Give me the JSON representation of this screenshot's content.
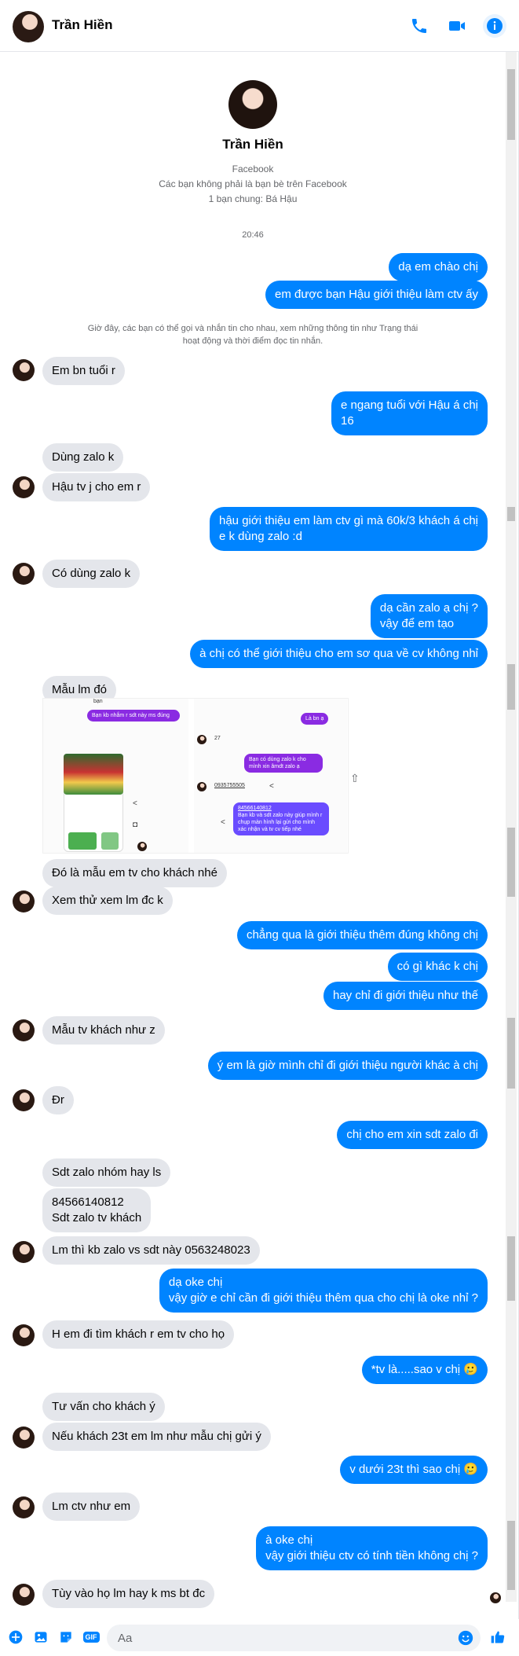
{
  "header": {
    "contact_name": "Trần Hiền",
    "icons": [
      "phone-icon",
      "video-icon",
      "info-icon"
    ]
  },
  "intro": {
    "name": "Trần Hiền",
    "source": "Facebook",
    "not_friends": "Các bạn không phải là bạn bè trên Facebook",
    "mutual": "1 bạn chung: Bá Hậu"
  },
  "timestamp": "20:46",
  "system_note": "Giờ đây, các bạn có thể gọi và nhắn tin cho nhau, xem những thông tin như Trạng thái hoạt động và thời điểm đọc tin nhắn.",
  "messages": [
    {
      "dir": "out",
      "text": "dạ em chào chị"
    },
    {
      "dir": "out",
      "text": "em được bạn Hậu giới thiệu làm ctv ấy"
    },
    {
      "dir": "in",
      "text": "Em bn tuổi r"
    },
    {
      "dir": "out",
      "text": "e ngang tuổi với Hậu á chị\n16"
    },
    {
      "dir": "in",
      "text": "Dùng zalo k"
    },
    {
      "dir": "in",
      "text": "Hậu tv j cho em r"
    },
    {
      "dir": "out",
      "text": "hậu giới thiệu em làm ctv gì mà 60k/3 khách á chị\ne k dùng zalo :d"
    },
    {
      "dir": "in",
      "text": "Có dùng zalo k"
    },
    {
      "dir": "out",
      "text": "dạ cần zalo ạ chị ?\nvậy để em tạo"
    },
    {
      "dir": "out",
      "text": "à chị có thể giới thiệu cho em sơ qua về cv không nhỉ"
    },
    {
      "dir": "in",
      "text": "Mẫu lm đó"
    },
    {
      "dir": "in",
      "text": "Đó là mẫu em tv cho khách nhé"
    },
    {
      "dir": "in",
      "text": "Xem thử xem lm đc k"
    },
    {
      "dir": "out",
      "text": "chẳng qua là giới thiệu thêm đúng không chị"
    },
    {
      "dir": "out",
      "text": "có gì khác k chị"
    },
    {
      "dir": "out",
      "text": "hay chỉ đi giới thiệu như thế"
    },
    {
      "dir": "in",
      "text": "Mẫu tv khách như z"
    },
    {
      "dir": "out",
      "text": "ý em là giờ mình chỉ đi giới thiệu người khác à chị"
    },
    {
      "dir": "in",
      "text": "Đr"
    },
    {
      "dir": "out",
      "text": "chị cho em xin sdt zalo đi"
    },
    {
      "dir": "in",
      "text": "Sdt zalo nhóm hay ls"
    },
    {
      "dir": "in",
      "text": "84566140812\nSdt zalo tv khách"
    },
    {
      "dir": "in",
      "text": "Lm thì kb zalo vs sdt này 0563248023"
    },
    {
      "dir": "out",
      "text": "dạ oke chị\nvậy giờ e chỉ cần đi giới thiệu thêm qua cho chị là oke nhỉ ?"
    },
    {
      "dir": "in",
      "text": "H em đi tìm khách r em tv cho họ"
    },
    {
      "dir": "out",
      "text": "*tv là.....sao v chị 🥲"
    },
    {
      "dir": "in",
      "text": "Tư vấn cho khách ý"
    },
    {
      "dir": "in",
      "text": "Nếu khách 23t em lm như mẫu chị gửi ý"
    },
    {
      "dir": "out",
      "text": "v dưới 23t thì sao chị 🥲"
    },
    {
      "dir": "in",
      "text": "Lm ctv như em"
    },
    {
      "dir": "out",
      "text": "à oke chị\nvậy giới thiệu ctv có tính tiền không chị ?"
    },
    {
      "dir": "in",
      "text": "Tùy vào họ lm hay k ms bt đc"
    }
  ],
  "image_message": {
    "left": {
      "top_text": "bạn",
      "bubble": "Bạn kb nhắm r sdt này ms đúng"
    },
    "right": {
      "bubble_top": "Là bn ạ",
      "count": "27",
      "bubble_mid": "Bạn có dùng zalo k cho mình xin âmdt zalo ạ",
      "phone": "0935755505",
      "bubble_bottom_num": "84566140812",
      "bubble_bottom": "Bạn kb và sdt zalo này giúp mình r chụp màn hình lại gửi cho mình xác nhận và tv cv tiếp nhé"
    }
  },
  "composer": {
    "placeholder": "Aa"
  },
  "colors": {
    "accent": "#0084ff",
    "incoming_bubble": "#e4e6eb",
    "purple_bubble": "#8a2be2"
  }
}
